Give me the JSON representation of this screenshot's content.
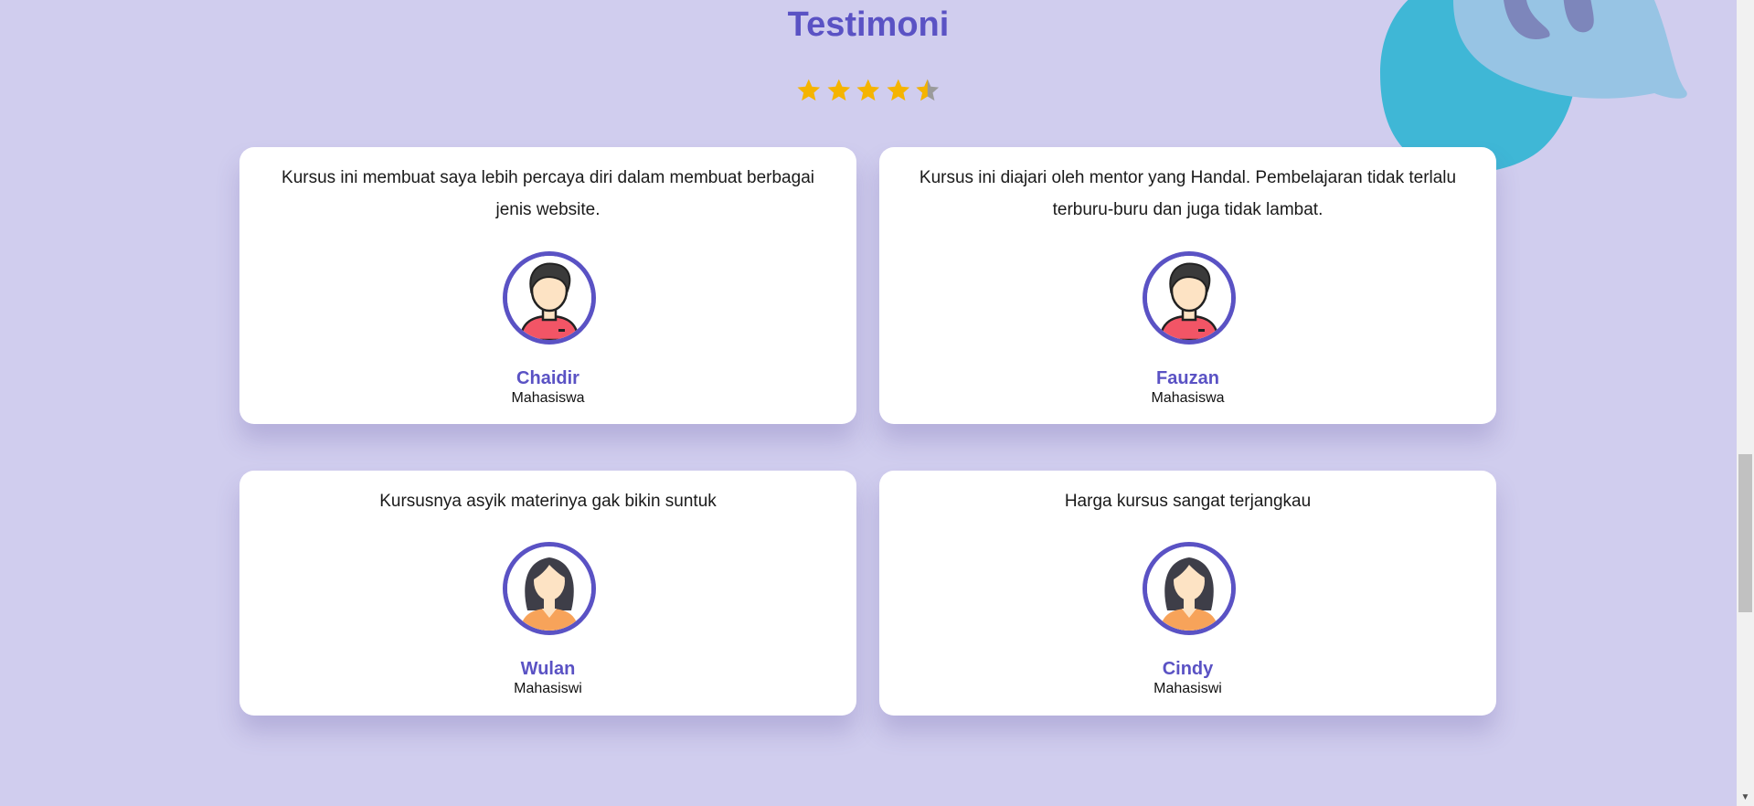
{
  "section": {
    "title": "Testimoni",
    "rating": 4.5
  },
  "testimonials": [
    {
      "quote": "Kursus ini membuat saya lebih percaya diri dalam membuat berbagai jenis website.",
      "name": "Chaidir",
      "role": "Mahasiswa",
      "avatar": "male-avatar-icon"
    },
    {
      "quote": "Kursus ini diajari oleh mentor yang Handal. Pembelajaran tidak terlalu terburu-buru dan juga tidak lambat.",
      "name": "Fauzan",
      "role": "Mahasiswa",
      "avatar": "male-avatar-icon"
    },
    {
      "quote": "Kursusnya asyik materinya gak bikin suntuk",
      "name": "Wulan",
      "role": "Mahasiswi",
      "avatar": "female-avatar-icon"
    },
    {
      "quote": "Harga kursus sangat terjangkau",
      "name": "Cindy",
      "role": "Mahasiswi",
      "avatar": "female-avatar-icon"
    }
  ],
  "colors": {
    "background": "#d0cdee",
    "accent": "#5a52c4",
    "star": "#f5b400",
    "star_empty": "#9a9a9a"
  },
  "scrollbar": {
    "arrow_icon": "chevron-down-icon"
  }
}
